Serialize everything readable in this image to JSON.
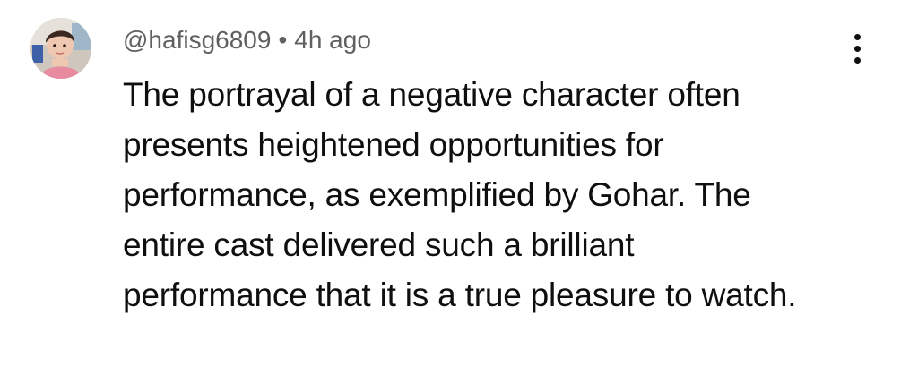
{
  "comment": {
    "author": "@hafisg6809",
    "separator": "•",
    "timestamp": "4h ago",
    "text": "The portrayal of a negative character often presents heightened opportunities for performance, as exemplified by Gohar. The entire cast delivered such a brilliant performance that it is a true pleasure to watch.",
    "menu_icon": "more-vertical-icon"
  },
  "colors": {
    "meta_text": "#606060",
    "body_text": "#0f0f0f",
    "background": "#ffffff"
  }
}
